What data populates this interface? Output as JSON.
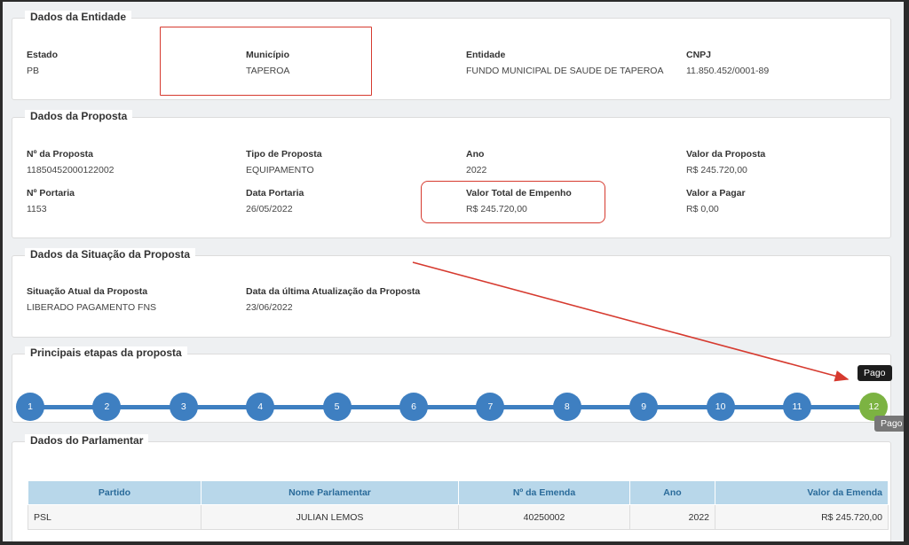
{
  "entidade": {
    "title": "Dados da Entidade",
    "fields": [
      {
        "label": "Estado",
        "value": "PB"
      },
      {
        "label": "Município",
        "value": "TAPEROA"
      },
      {
        "label": "Entidade",
        "value": "FUNDO MUNICIPAL DE SAUDE DE TAPEROA"
      },
      {
        "label": "CNPJ",
        "value": "11.850.452/0001-89"
      }
    ]
  },
  "proposta": {
    "title": "Dados da Proposta",
    "fields": [
      {
        "label": "Nº da Proposta",
        "value": "11850452000122002"
      },
      {
        "label": "Tipo de Proposta",
        "value": "EQUIPAMENTO"
      },
      {
        "label": "Ano",
        "value": "2022"
      },
      {
        "label": "Valor da Proposta",
        "value": "R$ 245.720,00"
      },
      {
        "label": "Nº Portaria",
        "value": "1153"
      },
      {
        "label": "Data Portaria",
        "value": "26/05/2022"
      },
      {
        "label": "Valor Total de Empenho",
        "value": "R$ 245.720,00"
      },
      {
        "label": "Valor a Pagar",
        "value": "R$ 0,00"
      }
    ]
  },
  "situacao": {
    "title": "Dados da Situação da Proposta",
    "fields": [
      {
        "label": "Situação Atual da Proposta",
        "value": "LIBERADO PAGAMENTO FNS"
      },
      {
        "label": "Data da última Atualização da Proposta",
        "value": "23/06/2022"
      }
    ]
  },
  "etapas": {
    "title": "Principais etapas da proposta",
    "steps": [
      "1",
      "2",
      "3",
      "4",
      "5",
      "6",
      "7",
      "8",
      "9",
      "10",
      "11",
      "12"
    ],
    "current_step": "12",
    "tooltip": "Pago",
    "tooltip_secondary": "Pago",
    "colors": {
      "pending": "#3e7fc1",
      "done": "#7cb342"
    }
  },
  "parlamentar": {
    "title": "Dados do Parlamentar",
    "columns": [
      "Partido",
      "Nome Parlamentar",
      "Nº da Emenda",
      "Ano",
      "Valor da Emenda"
    ],
    "rows": [
      [
        "PSL",
        "JULIAN LEMOS",
        "40250002",
        "2022",
        "R$ 245.720,00"
      ]
    ]
  },
  "annotation_color": "#d63a2f"
}
